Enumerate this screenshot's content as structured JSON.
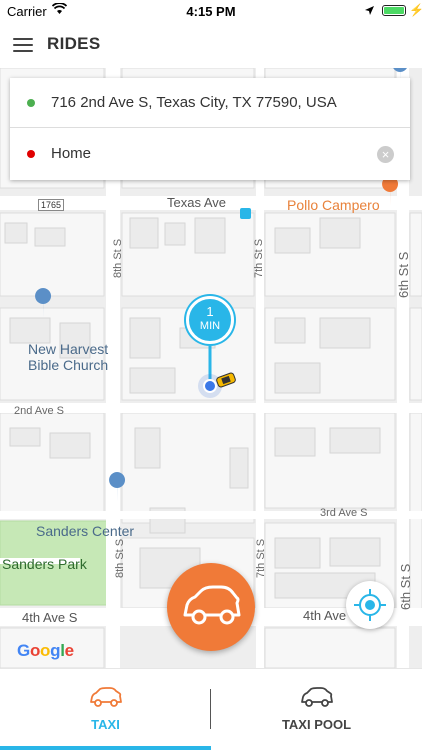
{
  "status": {
    "carrier": "Carrier",
    "time": "4:15 PM"
  },
  "nav": {
    "title": "RIDES"
  },
  "address": {
    "pickup": "716 2nd Ave S, Texas City, TX 77590, USA",
    "dropoff": "Home"
  },
  "map": {
    "streets": {
      "texas_ave": "Texas Ave",
      "second_ave": "2nd Ave S",
      "third_ave": "3rd Ave S",
      "fourth_ave_left": "4th Ave S",
      "fourth_ave_right": "4th Ave S",
      "eighth_st_top": "8th St S",
      "eighth_st_bottom": "8th St S",
      "seventh_st_top": "7th St S",
      "seventh_st_bottom": "7th St S",
      "sixth_st_top": "6th St S",
      "sixth_st_bottom": "6th St S",
      "route": "1765"
    },
    "pois": {
      "church_line1": "New Harvest",
      "church_line2": "Bible Church",
      "sanders_center": "Sanders Center",
      "sanders_park": "Sanders Park",
      "pollo": "Pollo Campero"
    },
    "google": [
      "G",
      "o",
      "o",
      "g",
      "l",
      "e"
    ],
    "google_colors": [
      "#4285f4",
      "#ea4335",
      "#fbbc05",
      "#4285f4",
      "#34a853",
      "#ea4335"
    ]
  },
  "eta": {
    "value": "1",
    "unit": "MIN"
  },
  "tabs": {
    "taxi": "TAXI",
    "pool": "TAXI POOL"
  },
  "colors": {
    "accent": "#29b6e8",
    "fab": "#f07a38",
    "pickup_dot": "#4caf50",
    "dropoff_dot": "#e00000"
  },
  "icons": {
    "menu": "hamburger-icon",
    "clear": "clear-icon",
    "car": "car-icon",
    "locate": "crosshair-icon"
  }
}
